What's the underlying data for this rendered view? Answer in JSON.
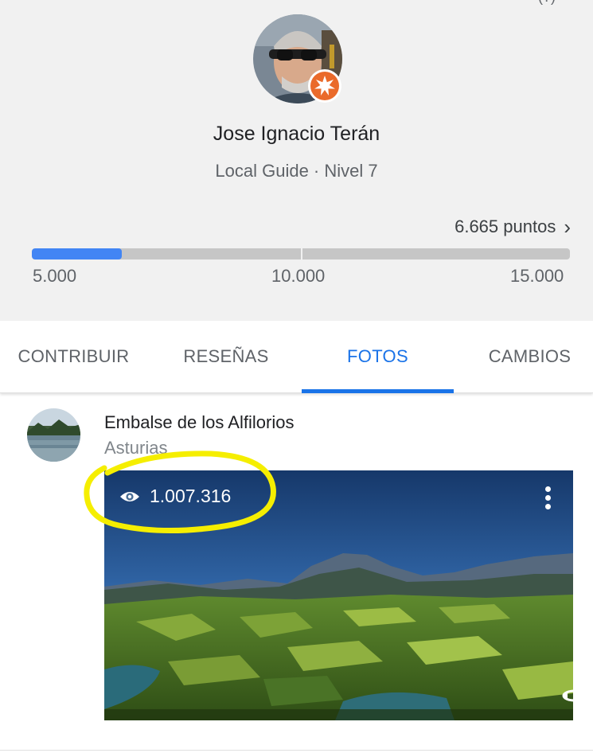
{
  "profile": {
    "name": "Jose Ignacio Terán",
    "level_text": "Local Guide · Nivel 7",
    "points_label": "6.665 puntos",
    "progress": {
      "min": 5000,
      "max": 15000,
      "value": 6665,
      "fraction": 0.1665,
      "ticks": [
        "5.000",
        "10.000",
        "15.000"
      ]
    },
    "badge_icon": "local-guide-star-icon",
    "badge_color": "#ea6a2a",
    "progress_color": "#4285f4"
  },
  "tabs": [
    {
      "label": "CONTRIBUIR",
      "active": false
    },
    {
      "label": "RESEÑAS",
      "active": false
    },
    {
      "label": "FOTOS",
      "active": true
    },
    {
      "label": "CAMBIOS",
      "active": false
    }
  ],
  "active_tab_color": "#1a73e8",
  "photo_item": {
    "place_name": "Embalse de los Alfilorios",
    "region": "Asturias",
    "views": "1.007.316",
    "view_icon": "eye-icon",
    "menu_icon": "more-vert-icon",
    "rotate_icon": "360-rotate-icon",
    "highlight_color": "#f5ee00"
  }
}
